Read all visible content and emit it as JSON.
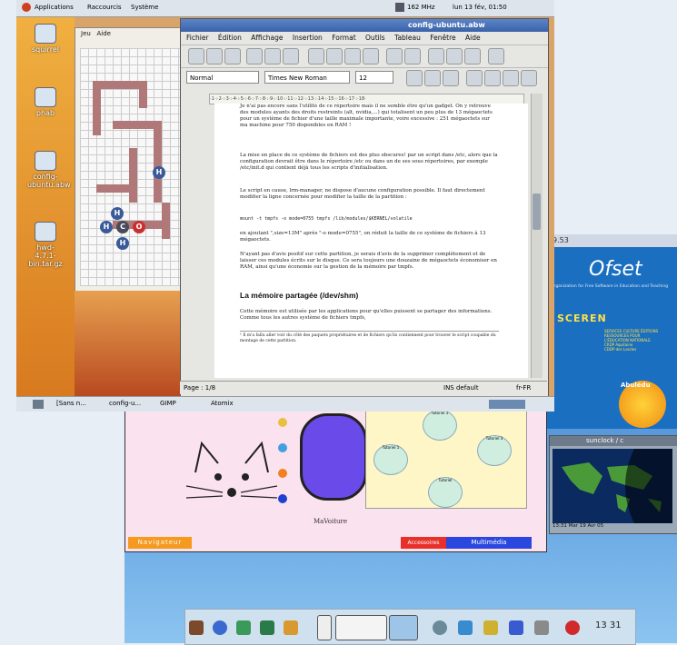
{
  "top_panel": {
    "menus": [
      "Applications",
      "Raccourcis",
      "Système"
    ],
    "cpu": "162 MHz",
    "clock": "lun 13 fév, 01:50"
  },
  "desktop_icons": [
    "squirrel",
    "phab",
    "config-ubuntu.abw",
    "hwd-4.7.1-bin.tar.gz"
  ],
  "molecule_window": {
    "menus": [
      "Jeu",
      "Aide"
    ],
    "atoms": [
      "H",
      "H",
      "C",
      "O",
      "H",
      "H"
    ]
  },
  "abiword": {
    "title": "config-ubuntu.abw",
    "menus": [
      "Fichier",
      "Édition",
      "Affichage",
      "Insertion",
      "Format",
      "Outils",
      "Tableau",
      "Fenêtre",
      "Aide"
    ],
    "style": "Normal",
    "font": "Times New Roman",
    "size": "12",
    "ruler": "·1·:·2·:·3·:·4·:·5·:·6·:·7·:·8·:·9·:·10·:·11·:·12·:·13·:·14·:·15·:·16·:·17·:·18·",
    "paragraphs": [
      "Je n'ai pas encore sans l'utilité de ce répertoire mais il ne semble être qu'un gadget. On y retrouve des modules ayants des droits restreints (alt, nvidia,...) qui totalisent un peu plus de 13 mégaoctets pour un système de fichier d'une taille maximale importante, voire excessive : 251 mégaoctets sur ma machine pour 750 disponibles en RAM !",
      "La mise en place de ce système de fichiers est des plus obscures! par un script dans /etc, alors que la configuration devrait être dans le répertoire /etc ou dans un de ses sous répertoires, par exemple /etc/init.d qui contient déjà tous les scripts d'initialisation.",
      "Le script en cause, lrm-manager, ne dispose d'aucune configuration possible. Il faut directement modifier la ligne concernée pour modifier la taille de la partition :",
      "mount -t tmpfs -o mode=0755 tmpfs /lib/modules/$KERNEL/volatile",
      "en ajoutant \",size=13M\" après \"-o mode=0755\", on réduit la taille de ce système de fichiers à 13 mégaoctets.",
      "N'ayant pas d'avis positif sur cette partition, je serais d'avis de la supprimer complètement et de laisser ces modules écrits sur le disque. Ce sera toujours une douzaine de mégaoctets économiser en RAM, ainsi qu'une économie sur la gestion de la mémoire par tmpfs."
    ],
    "heading": "La mémoire partagée (/dev/shm)",
    "paragraphs2": [
      "Cette mémoire est utilisée par les applications pour qu'elles puissent se partager des informations. Comme tous les autres système de fichiers tmpfs,",
      "¹ Il m'a fallu aller voir du côté des paquets propriétaires et de fichiers qu'ils contiennent pour trouver le script coupable du montage de cette partition."
    ],
    "status_page": "Page : 1/8",
    "status_ins": "INS  default",
    "status_lang": "fr-FR"
  },
  "taskbar": {
    "items": [
      "[Sans n...",
      "config-u...",
      "GIMP",
      "Atomix"
    ]
  },
  "background_window": {
    "strip_text": "9.53",
    "ofset": "Ofset",
    "ofset_sub": "Organization for Free Software in Education and Teaching",
    "scerene": "SCEREN",
    "scerene_sub": [
      "SERVICES CULTURE ÉDITIONS",
      "RESSOURCES POUR",
      "L'ÉDUCATION NATIONALE",
      "CRDP Aquitaine",
      "CDDP des Landes"
    ],
    "aquitaine": "Abulédu"
  },
  "sunclock": {
    "title": "sunclock / c",
    "status": "13:31 Mar 19 Avr 05"
  },
  "kids_app": {
    "car_label": "MaVoiture",
    "nav": "Navigateur",
    "accessories": "Accessoires",
    "multimedia": "Multimédia",
    "tutorials": [
      "Tutoriel 1",
      "Tutoriel 1",
      "Tutoriel 3",
      "Tutoriel"
    ]
  },
  "dock": {
    "time": "13 31"
  },
  "colors": {
    "accent": "#3a62a8",
    "desktop": "#d9a46a",
    "blue_desk": "#3a78c8"
  }
}
